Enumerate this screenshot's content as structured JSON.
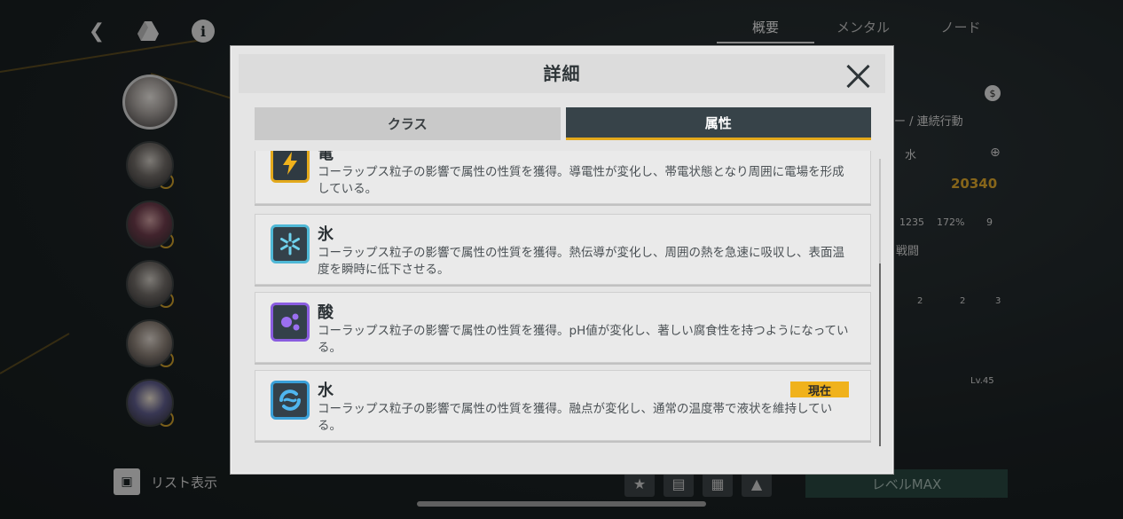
{
  "background": {
    "top_tabs": [
      "概要",
      "メンタル",
      "ノード"
    ],
    "active_top_tab": 0,
    "list_view_label": "リスト表示",
    "level_button_label": "レベルMAX",
    "right_panel": {
      "action_text": "ー / 連続行動",
      "element_text": "水",
      "power": "20340",
      "stats": [
        "1235",
        "172%",
        "9"
      ],
      "section_label": "戦闘",
      "skill_levels": [
        "2",
        "2",
        "3"
      ],
      "weapon_level": "Lv.45"
    }
  },
  "modal": {
    "title": "詳細",
    "tabs": [
      {
        "label": "クラス",
        "active": false
      },
      {
        "label": "属性",
        "active": true
      }
    ],
    "attributes": [
      {
        "name": "電",
        "icon": "lightning-icon",
        "color": "#e3a91c",
        "description": "コーラップス粒子の影響で属性の性質を獲得。導電性が変化し、帯電状態となり周囲に電場を形成している。",
        "current": false
      },
      {
        "name": "氷",
        "icon": "snowflake-icon",
        "color": "#4fb8d6",
        "description": "コーラップス粒子の影響で属性の性質を獲得。熱伝導が変化し、周囲の熱を急速に吸収し、表面温度を瞬時に低下させる。",
        "current": false
      },
      {
        "name": "酸",
        "icon": "acid-bubbles-icon",
        "color": "#8a5de0",
        "description": "コーラップス粒子の影響で属性の性質を獲得。pH値が変化し、著しい腐食性を持つようになっている。",
        "current": false
      },
      {
        "name": "水",
        "icon": "water-swirl-icon",
        "color": "#3aa0d8",
        "description": "コーラップス粒子の影響で属性の性質を獲得。融点が変化し、通常の温度帯で液状を維持している。",
        "current": true
      }
    ],
    "current_badge": "現在"
  }
}
